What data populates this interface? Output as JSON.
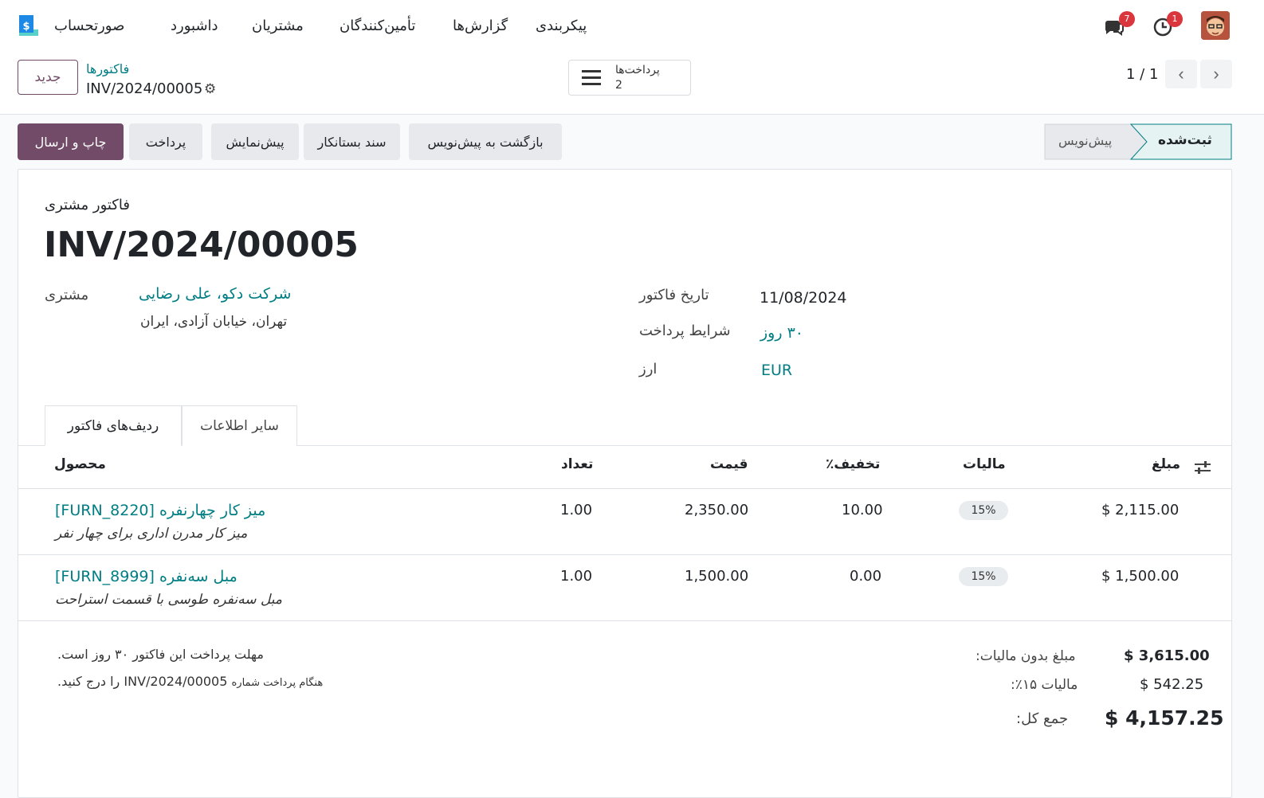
{
  "topbar": {
    "app_name": "صورتحساب",
    "menu": [
      "داشبورد",
      "مشتریان",
      "تأمین‌کنندگان",
      "گزارش‌ها",
      "پیکربندی"
    ],
    "messages_count": "7",
    "activities_count": "1"
  },
  "control_panel": {
    "new_button": "جدید",
    "breadcrumb_parent": "فاکتورها",
    "breadcrumb_current": "INV/2024/00005",
    "smart_button_label": "پرداخت‌ها",
    "smart_button_value": "2",
    "pager": "1 / 1"
  },
  "actions": {
    "print_send": "چاپ و ارسال",
    "payment": "پرداخت",
    "preview": "پیش‌نمایش",
    "credit_note": "سند بستانکار",
    "reset_draft": "بازگشت به پیش‌نویس"
  },
  "status": {
    "posted": "ثبت‌شده",
    "draft": "پیش‌نویس"
  },
  "form": {
    "type_label": "فاکتور مشتری",
    "number": "INV/2024/00005",
    "customer_label": "مشتری",
    "customer_name": "شرکت دکو، علی رضایی",
    "customer_address": "تهران، خیابان آزادی، ایران",
    "invoice_date_label": "تاریخ فاکتور",
    "invoice_date": "11/08/2024",
    "payment_terms_label": "شرایط پرداخت",
    "payment_terms": "۳۰ روز",
    "currency_label": "ارز",
    "currency": "EUR"
  },
  "tabs": [
    "ردیف‌های فاکتور",
    "سایر اطلاعات"
  ],
  "table": {
    "headers": {
      "product": "محصول",
      "qty": "تعداد",
      "price": "قیمت",
      "discount": "تخفیف٪",
      "taxes": "مالیات",
      "amount": "مبلغ"
    },
    "rows": [
      {
        "product": "میز کار چهارنفره [FURN_8220]",
        "description": "میز کار مدرن اداری برای چهار نفر",
        "qty": "1.00",
        "price": "2,350.00",
        "discount": "10.00",
        "tax": "15%",
        "amount": "$ 2,115.00"
      },
      {
        "product": "مبل سه‌نفره [FURN_8999]",
        "description": "مبل سه‌نفره طوسی با قسمت استراحت",
        "qty": "1.00",
        "price": "1,500.00",
        "discount": "0.00",
        "tax": "15%",
        "amount": "$ 1,500.00"
      }
    ]
  },
  "notes": {
    "line1": "مهلت پرداخت این فاکتور ۳۰ روز است.",
    "line2_prefix": "هنگام پرداخت شماره",
    "line2_ref": "INV/2024/00005",
    "line2_suffix": "را درج کنید."
  },
  "totals": {
    "untaxed_label": "مبلغ بدون مالیات:",
    "untaxed": "$ 3,615.00",
    "tax_label": "مالیات ۱۵٪:",
    "tax": "$ 542.25",
    "total_label": "جمع کل:",
    "total": "$ 4,157.25"
  },
  "colors": {
    "brand": "#714b67",
    "link": "#017e84",
    "badge": "#d9363e"
  }
}
